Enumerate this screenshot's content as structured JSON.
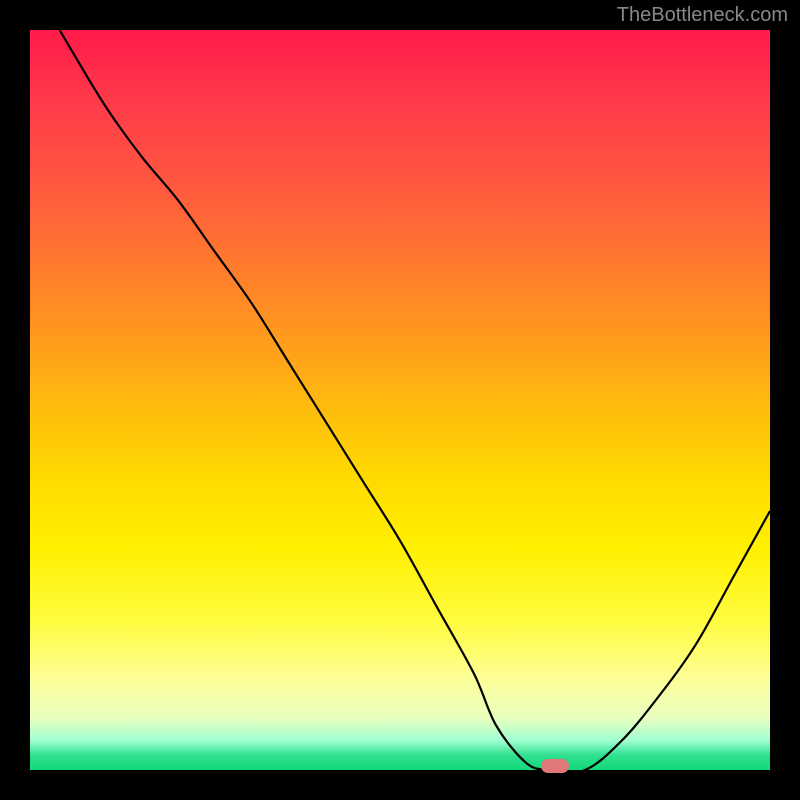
{
  "watermark": "TheBottleneck.com",
  "chart_data": {
    "type": "line",
    "title": "",
    "xlabel": "",
    "ylabel": "",
    "xlim": [
      0,
      100
    ],
    "ylim": [
      0,
      100
    ],
    "background_gradient": {
      "top_color": "#ff1a4a",
      "bottom_color": "#14d878",
      "meaning": "bottleneck percentage heat (red=high, green=low)"
    },
    "series": [
      {
        "name": "bottleneck-curve",
        "x": [
          4,
          10,
          15,
          20,
          25,
          30,
          35,
          40,
          45,
          50,
          55,
          60,
          63,
          67,
          70,
          75,
          80,
          85,
          90,
          95,
          100
        ],
        "y": [
          100,
          90,
          83,
          77,
          70,
          63,
          55,
          47,
          39,
          31,
          22,
          13,
          6,
          1,
          0,
          0,
          4,
          10,
          17,
          26,
          35
        ]
      }
    ],
    "marker": {
      "x": 71,
      "y": 0.5,
      "color": "#e07878",
      "shape": "rounded-bar"
    }
  }
}
